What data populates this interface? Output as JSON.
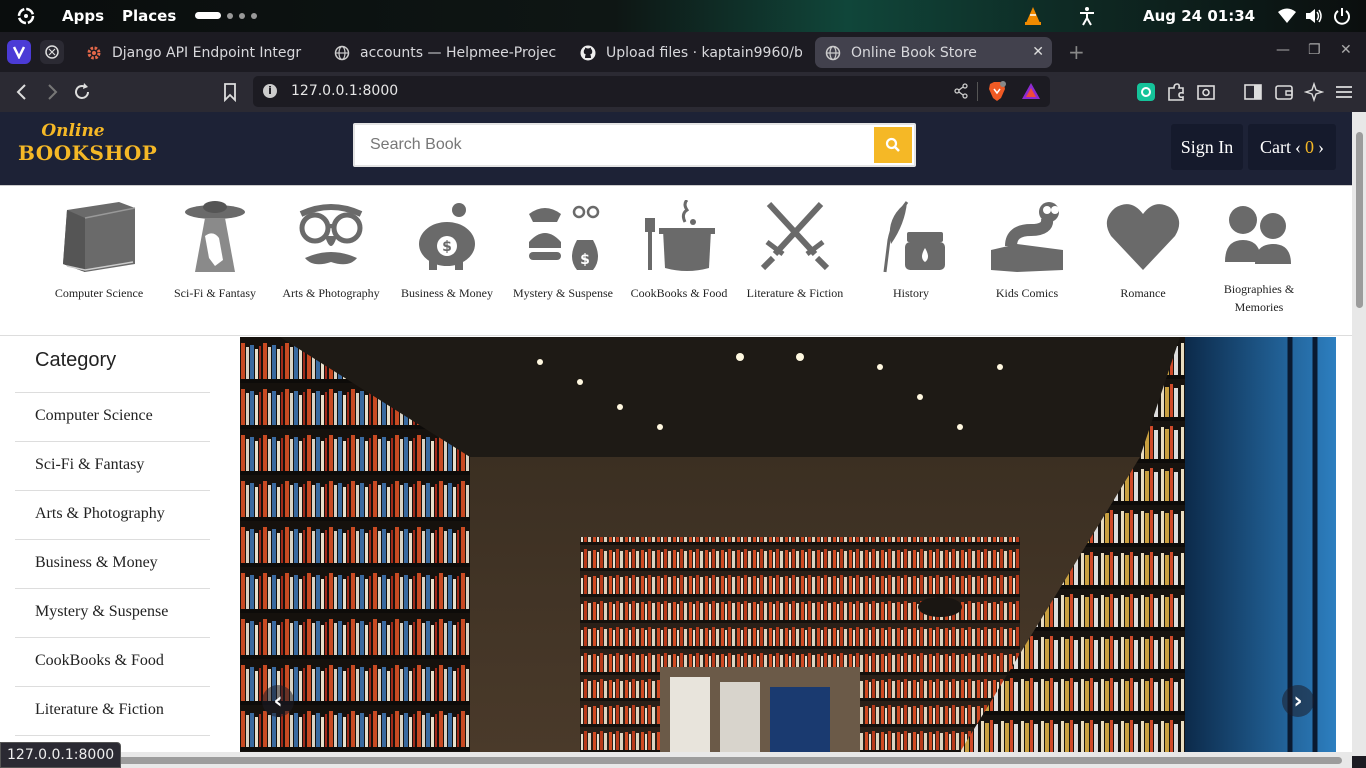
{
  "topbar": {
    "apps": "Apps",
    "places": "Places",
    "clock": "Aug 24  01:34"
  },
  "browser": {
    "tabs": [
      {
        "title": "Django API Endpoint Integr"
      },
      {
        "title": "accounts — Helpmee-Projec"
      },
      {
        "title": "Upload files · kaptain9960/b"
      },
      {
        "title": "Online Book Store"
      }
    ],
    "url": "127.0.0.1:8000",
    "status_url": "127.0.0.1:8000"
  },
  "site": {
    "logo_line1": "Online",
    "logo_line2": "BOOKSHOP",
    "search_placeholder": "Search Book",
    "signin": "Sign In",
    "cart_label": "Cart",
    "cart_count": "0",
    "colors": {
      "header": "#1d2236",
      "accent": "#f5b826"
    }
  },
  "categories_bar": [
    {
      "label": "Computer Science",
      "icon": "book-icon"
    },
    {
      "label": "Sci-Fi & Fantasy",
      "icon": "ufo-icon"
    },
    {
      "label": "Arts & Photography",
      "icon": "disguise-glasses-icon"
    },
    {
      "label": "Business & Money",
      "icon": "piggy-bank-icon"
    },
    {
      "label": "Mystery & Suspense",
      "icon": "detective-icon"
    },
    {
      "label": "CookBooks & Food",
      "icon": "cooking-pot-icon"
    },
    {
      "label": "Literature & Fiction",
      "icon": "crossed-swords-icon"
    },
    {
      "label": "History",
      "icon": "quill-ink-icon"
    },
    {
      "label": "Kids Comics",
      "icon": "worm-book-icon"
    },
    {
      "label": "Romance",
      "icon": "heart-icon"
    },
    {
      "label": "Biographies & Memories",
      "icon": "people-icon"
    }
  ],
  "sidebar": {
    "title": "Category",
    "items": [
      "Computer Science",
      "Sci-Fi & Fantasy",
      "Arts & Photography",
      "Business & Money",
      "Mystery & Suspense",
      "CookBooks & Food",
      "Literature & Fiction"
    ]
  }
}
